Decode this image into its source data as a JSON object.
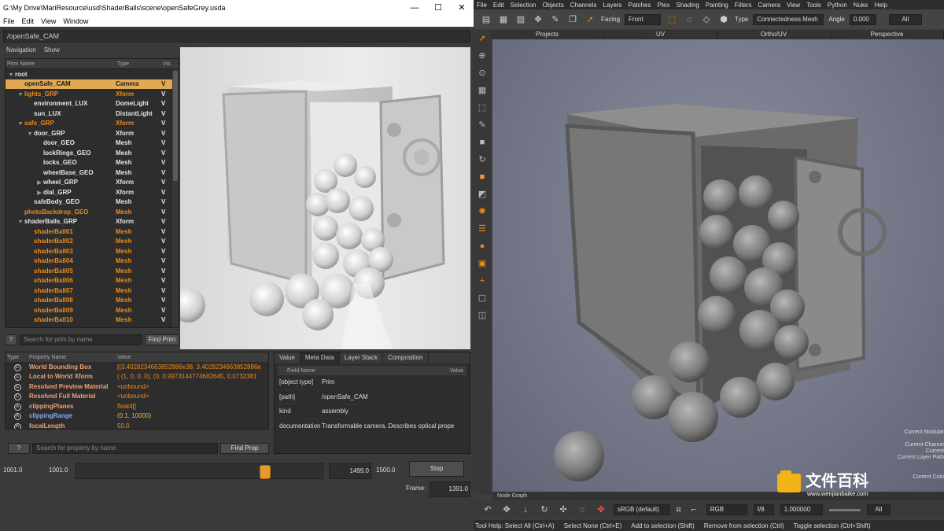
{
  "usdview": {
    "window_title": "G:\\My Drive\\MariResource\\usd\\ShaderBalls\\scene\\openSafeGrey.usda",
    "menu": [
      "File",
      "Edit",
      "View",
      "Window"
    ],
    "path": "/openSafe_CAM",
    "nav": [
      "Navigation",
      "Show"
    ],
    "tree_headers": [
      "Prim Name",
      "Type",
      "Vis"
    ],
    "tree": [
      {
        "name": "root",
        "type": "",
        "vis": "",
        "depth": 0,
        "tri": "▼",
        "style": "normal"
      },
      {
        "name": "openSafe_CAM",
        "type": "Camera",
        "vis": "V",
        "depth": 1,
        "tri": "",
        "style": "sel"
      },
      {
        "name": "lights_GRP",
        "type": "Xform",
        "vis": "V",
        "depth": 1,
        "tri": "▼",
        "style": "orange"
      },
      {
        "name": "environment_LUX",
        "type": "DomeLight",
        "vis": "V",
        "depth": 2,
        "tri": "",
        "style": "normal"
      },
      {
        "name": "sun_LUX",
        "type": "DistantLight",
        "vis": "V",
        "depth": 2,
        "tri": "",
        "style": "normal"
      },
      {
        "name": "safe_GRP",
        "type": "Xform",
        "vis": "V",
        "depth": 1,
        "tri": "▼",
        "style": "orange"
      },
      {
        "name": "door_GRP",
        "type": "Xform",
        "vis": "V",
        "depth": 2,
        "tri": "▼",
        "style": "normal"
      },
      {
        "name": "door_GEO",
        "type": "Mesh",
        "vis": "V",
        "depth": 3,
        "tri": "",
        "style": "normal"
      },
      {
        "name": "lockRings_GEO",
        "type": "Mesh",
        "vis": "V",
        "depth": 3,
        "tri": "",
        "style": "normal"
      },
      {
        "name": "locks_GEO",
        "type": "Mesh",
        "vis": "V",
        "depth": 3,
        "tri": "",
        "style": "normal"
      },
      {
        "name": "wheelBase_GEO",
        "type": "Mesh",
        "vis": "V",
        "depth": 3,
        "tri": "",
        "style": "normal"
      },
      {
        "name": "wheel_GRP",
        "type": "Xform",
        "vis": "V",
        "depth": 3,
        "tri": "▶",
        "style": "normal"
      },
      {
        "name": "dial_GRP",
        "type": "Xform",
        "vis": "V",
        "depth": 3,
        "tri": "▶",
        "style": "normal"
      },
      {
        "name": "safeBody_GEO",
        "type": "Mesh",
        "vis": "V",
        "depth": 2,
        "tri": "",
        "style": "normal"
      },
      {
        "name": "photoBackdrop_GEO",
        "type": "Mesh",
        "vis": "V",
        "depth": 1,
        "tri": "",
        "style": "orange"
      },
      {
        "name": "shaderBalls_GRP",
        "type": "Xform",
        "vis": "V",
        "depth": 1,
        "tri": "▼",
        "style": "normal"
      },
      {
        "name": "shaderBall01",
        "type": "Mesh",
        "vis": "V",
        "depth": 2,
        "tri": "",
        "style": "orange"
      },
      {
        "name": "shaderBall02",
        "type": "Mesh",
        "vis": "V",
        "depth": 2,
        "tri": "",
        "style": "orange"
      },
      {
        "name": "shaderBall03",
        "type": "Mesh",
        "vis": "V",
        "depth": 2,
        "tri": "",
        "style": "orange"
      },
      {
        "name": "shaderBall04",
        "type": "Mesh",
        "vis": "V",
        "depth": 2,
        "tri": "",
        "style": "orange"
      },
      {
        "name": "shaderBall05",
        "type": "Mesh",
        "vis": "V",
        "depth": 2,
        "tri": "",
        "style": "orange"
      },
      {
        "name": "shaderBall06",
        "type": "Mesh",
        "vis": "V",
        "depth": 2,
        "tri": "",
        "style": "orange"
      },
      {
        "name": "shaderBall07",
        "type": "Mesh",
        "vis": "V",
        "depth": 2,
        "tri": "",
        "style": "orange"
      },
      {
        "name": "shaderBall08",
        "type": "Mesh",
        "vis": "V",
        "depth": 2,
        "tri": "",
        "style": "orange"
      },
      {
        "name": "shaderBall09",
        "type": "Mesh",
        "vis": "V",
        "depth": 2,
        "tri": "",
        "style": "orange"
      },
      {
        "name": "shaderBall10",
        "type": "Mesh",
        "vis": "V",
        "depth": 2,
        "tri": "",
        "style": "orange"
      }
    ],
    "search_prim_placeholder": "Search for prim by name",
    "find_prim": "Find Prim",
    "help_btn": "?",
    "prop_headers": [
      "Type",
      "Property Name",
      "Value"
    ],
    "props": [
      {
        "icon": "C",
        "name": "World Bounding Box",
        "value": "[(3.4028234663852886e38, 3.4028234663852886e",
        "style": "normal"
      },
      {
        "icon": "C",
        "name": "Local to World Xform",
        "value": "( (1, 0, 0, 0), (0, 0.9973144774682645, 0.0732381",
        "style": "normal"
      },
      {
        "icon": "C",
        "name": "Resolved Preview Material",
        "value": "<unbound>",
        "style": "normal"
      },
      {
        "icon": "C",
        "name": "Resolved Full Material",
        "value": "<unbound>",
        "style": "normal"
      },
      {
        "icon": "A",
        "name": "clippingPlanes",
        "value": "float4[]",
        "style": "normal"
      },
      {
        "icon": "A",
        "name": "clippingRange",
        "value": "(0.1, 10000)",
        "style": "blue"
      },
      {
        "icon": "A",
        "name": "focalLength",
        "value": "50.0",
        "style": "normal"
      }
    ],
    "search_prop_placeholder": "Search for property by name",
    "find_prop": "Find Prop",
    "meta_tabs": [
      "Value",
      "Meta Data",
      "Layer Stack",
      "Composition"
    ],
    "meta_headers": [
      "Field Name",
      "Value"
    ],
    "meta_rows": [
      {
        "field": "[object type]",
        "value": "Prim"
      },
      {
        "field": "[path]",
        "value": "/openSafe_CAM"
      },
      {
        "field": "kind",
        "value": "assembly"
      },
      {
        "field": "documentation",
        "value": "Transformable camera. Describes optical prope"
      }
    ],
    "timeline": {
      "start_label": "1001.0",
      "start_field": "1001.0",
      "end_field": "1499.0",
      "end_label": "1500.0",
      "stop": "Stop",
      "frame_label": "Frame:",
      "frame_value": "1391.0",
      "position": 0.78
    }
  },
  "mari": {
    "menu": [
      "File",
      "Edit",
      "Selection",
      "Objects",
      "Channels",
      "Layers",
      "Patches",
      "Ptex",
      "Shading",
      "Painting",
      "Filters",
      "Camera",
      "View",
      "Tools",
      "Python",
      "Nuke",
      "Help"
    ],
    "toolbar": {
      "facing_label": "Facing",
      "facing_value": "Front",
      "type_label": "Type",
      "type_value": "Connectedness Mesh",
      "angle_label": "Angle",
      "angle_value": "0.000",
      "all_label": "All"
    },
    "view_tabs": [
      "Projects",
      "UV",
      "Ortho/UV",
      "Perspective"
    ],
    "overlays": [
      "Current Modular",
      "Current Channe",
      "Current",
      "Current Layer Path",
      "Current Colo"
    ],
    "node_graph": "Node Graph",
    "bottom": {
      "colorspace": "sRGB (default)",
      "r_label": "R",
      "channel": "RGB",
      "fstop": "f/8",
      "value": "1.000000",
      "all": "All"
    },
    "status": [
      "Tool Help: Select All (Ctrl+A)",
      "Select None (Ctrl+E)",
      "Add to selection (Shift)",
      "Remove from selection (Ctrl)",
      "Toggle selection (Ctrl+Shift)"
    ]
  },
  "watermark": {
    "title": "文件百科",
    "url": "www.wenjianbaike.com"
  },
  "colors": {
    "accent_orange": "#f08a1a",
    "selection": "#e0a953",
    "knob": "#e89a2b"
  }
}
